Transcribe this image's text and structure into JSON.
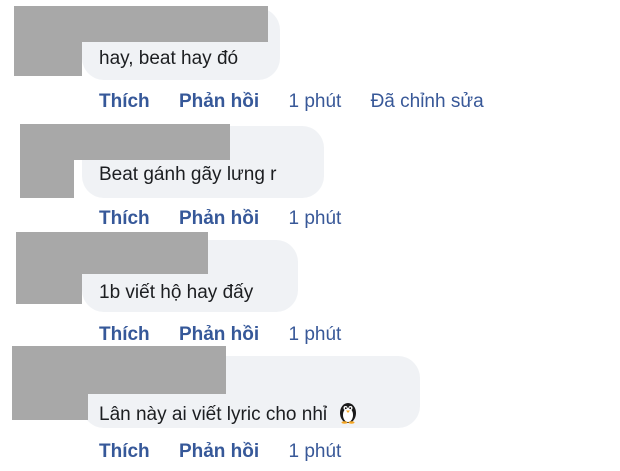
{
  "comments": [
    {
      "text": "hay, beat hay đó",
      "like_label": "Thích",
      "reply_label": "Phản hồi",
      "time": "1 phút",
      "edited": "Đã chỉnh sửa"
    },
    {
      "text": "Beat gánh gãy lưng r",
      "like_label": "Thích",
      "reply_label": "Phản hồi",
      "time": "1 phút"
    },
    {
      "text": "1b viết hộ hay đấy",
      "like_label": "Thích",
      "reply_label": "Phản hồi",
      "time": "1 phút"
    },
    {
      "text": "Lân này ai viết lyric cho nhỉ",
      "emoji": "penguin-icon",
      "like_label": "Thích",
      "reply_label": "Phản hồi",
      "time": "1 phút"
    }
  ],
  "colors": {
    "link": "#365899",
    "bubble": "#f0f2f5",
    "redaction": "#a8a8a8",
    "text": "#1c1e21"
  }
}
